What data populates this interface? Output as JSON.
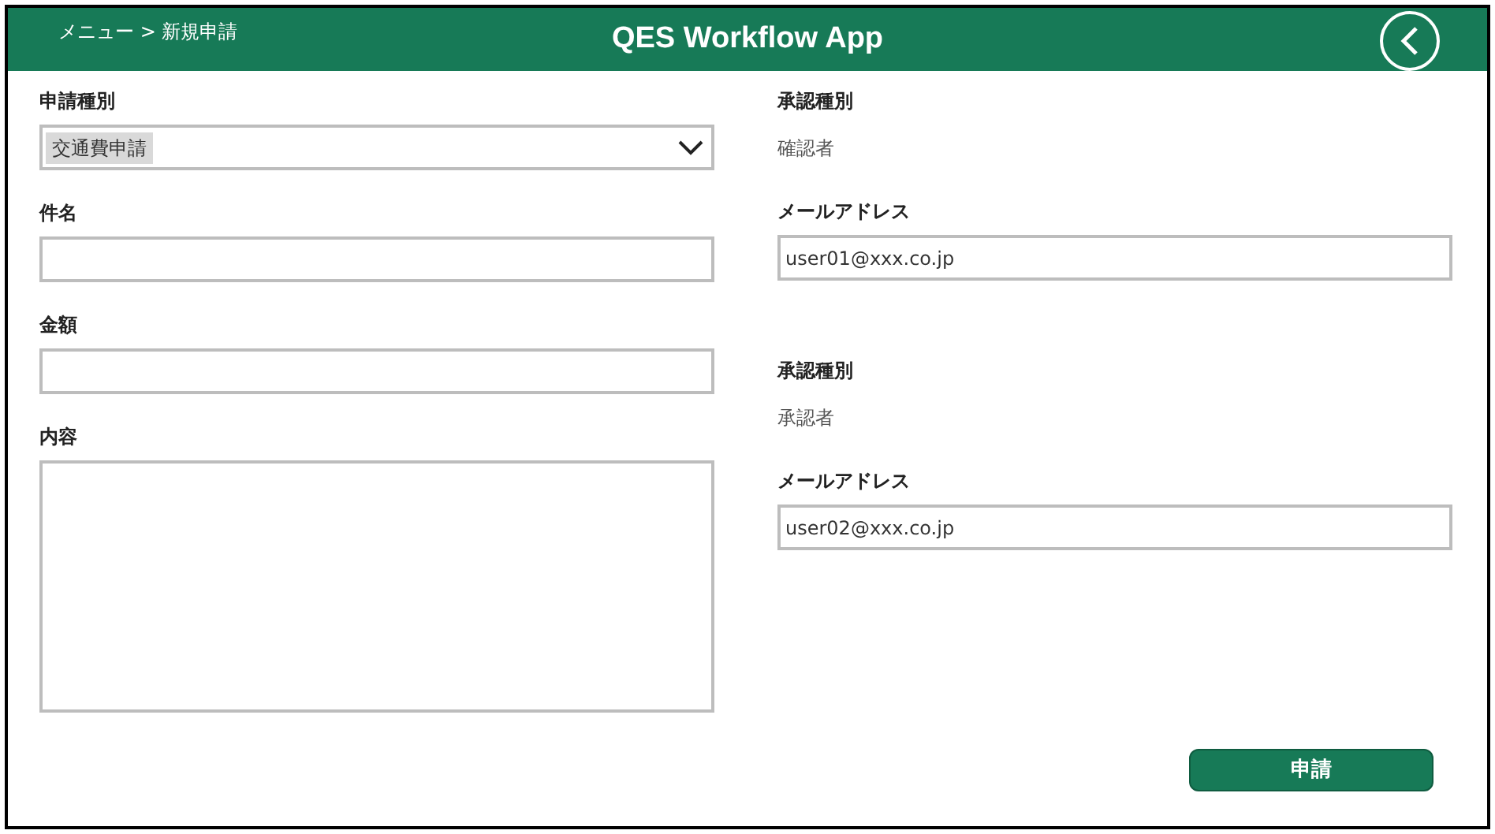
{
  "header": {
    "breadcrumb": "メニュー > 新規申請",
    "title": "QES Workflow App"
  },
  "form_fields": [
    {
      "label": "申請種別",
      "kind": "select",
      "value": "交通費申請"
    },
    {
      "label": "件名",
      "kind": "text"
    },
    {
      "label": "金額",
      "kind": "text"
    },
    {
      "label": "内容",
      "kind": "textarea"
    }
  ],
  "approvers": [
    {
      "type_label": "承認種別",
      "type_value": "確認者",
      "email_label": "メールアドレス",
      "email": "user01@xxx.co.jp"
    },
    {
      "type_label": "承認種別",
      "type_value": "承認者",
      "email_label": "メールアドレス",
      "email": "user02@xxx.co.jp"
    }
  ],
  "submit_button": "申請"
}
